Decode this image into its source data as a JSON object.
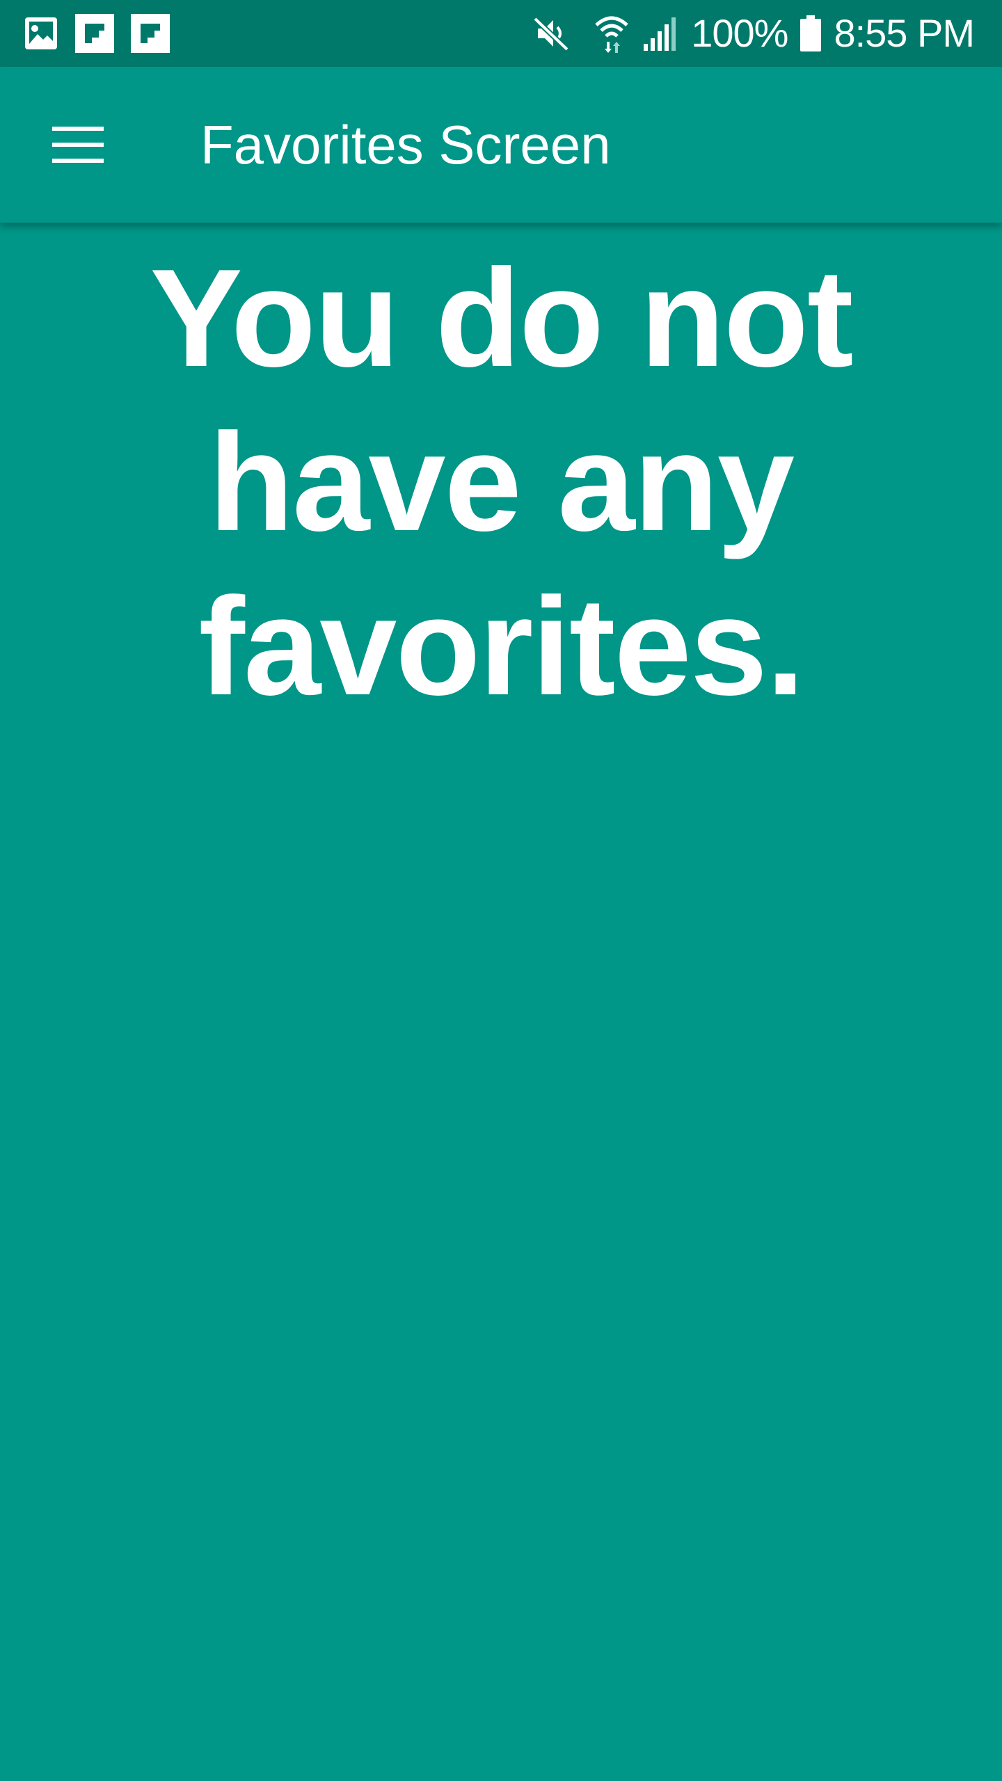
{
  "status_bar": {
    "battery_text": "100%",
    "time": "8:55 PM",
    "left_icons": [
      "image-notification-icon",
      "flipboard-icon",
      "flipboard-icon"
    ],
    "right_icons": [
      "mute-icon",
      "wifi-icon",
      "signal-icon",
      "battery-icon"
    ],
    "background": "#00796B"
  },
  "app_bar": {
    "title": "Favorites Screen",
    "menu_icon": "hamburger-menu-icon",
    "background": "#009688"
  },
  "main": {
    "message": "You do not have any favorites.",
    "background": "#009688",
    "text_color": "#FFFFFF"
  }
}
